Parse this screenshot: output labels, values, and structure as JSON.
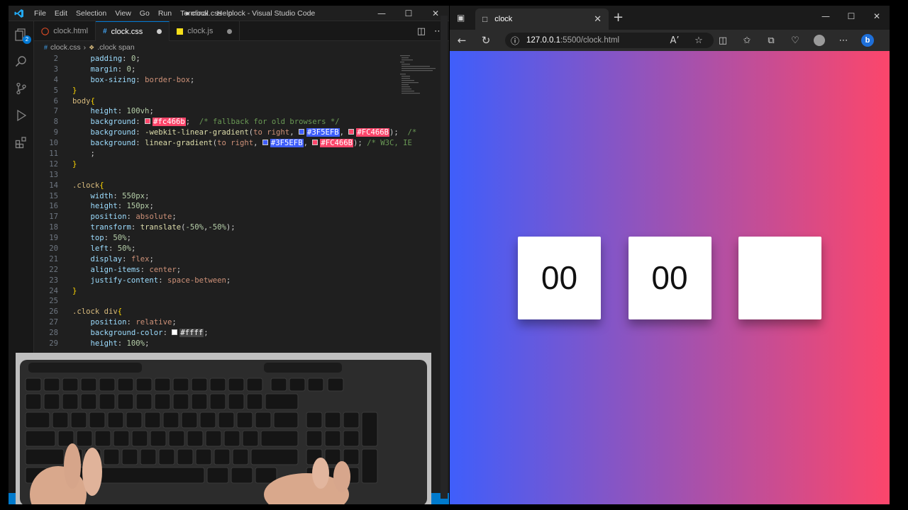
{
  "vscode": {
    "menu": [
      "File",
      "Edit",
      "Selection",
      "View",
      "Go",
      "Run",
      "Terminal",
      "Help"
    ],
    "title": "● clock.css - clock - Visual Studio Code",
    "activity_badge": "2",
    "tabs": [
      {
        "label": "clock.html",
        "icon": "html5-icon"
      },
      {
        "label": "clock.css",
        "icon": "css3-icon"
      },
      {
        "label": "clock.js",
        "icon": "js-icon"
      }
    ],
    "breadcrumb": [
      "clock.css",
      ".clock span"
    ],
    "code_lines": [
      {
        "n": "2",
        "text": "    padding: 0;"
      },
      {
        "n": "3",
        "text": "    margin: 0;"
      },
      {
        "n": "4",
        "text": "    box-sizing: border-box;"
      },
      {
        "n": "5",
        "text": "}"
      },
      {
        "n": "6",
        "text": "body{"
      },
      {
        "n": "7",
        "text": "    height: 100vh;"
      },
      {
        "n": "8",
        "text": "    background: #fc466b;  /* fallback for old browsers */"
      },
      {
        "n": "9",
        "text": "    background: -webkit-linear-gradient(to right, #3F5EFB, #FC466B);  /*"
      },
      {
        "n": "10",
        "text": "    background: linear-gradient(to right, #3F5EFB, #FC466B); /* W3C, IE"
      },
      {
        "n": "11",
        "text": "    ;"
      },
      {
        "n": "12",
        "text": "}"
      },
      {
        "n": "13",
        "text": ""
      },
      {
        "n": "14",
        "text": ".clock{"
      },
      {
        "n": "15",
        "text": "    width: 550px;"
      },
      {
        "n": "16",
        "text": "    height: 150px;"
      },
      {
        "n": "17",
        "text": "    position: absolute;"
      },
      {
        "n": "18",
        "text": "    transform: translate(-50%,-50%);"
      },
      {
        "n": "19",
        "text": "    top: 50%;"
      },
      {
        "n": "20",
        "text": "    left: 50%;"
      },
      {
        "n": "21",
        "text": "    display: flex;"
      },
      {
        "n": "22",
        "text": "    align-items: center;"
      },
      {
        "n": "23",
        "text": "    justify-content: space-between;"
      },
      {
        "n": "24",
        "text": "}"
      },
      {
        "n": "25",
        "text": ""
      },
      {
        "n": "26",
        "text": ".clock div{"
      },
      {
        "n": "27",
        "text": "    position: relative;"
      },
      {
        "n": "28",
        "text": "    background-color: #ffff;"
      },
      {
        "n": "29",
        "text": "    height: 100%;"
      }
    ]
  },
  "browser": {
    "tab_title": "clock",
    "url_host": "127.0.0.1",
    "url_rest": ":5500/clock.html",
    "clock_boxes": [
      "00",
      "00",
      ""
    ]
  },
  "colors": {
    "gradient_start": "#3F5EFB",
    "gradient_end": "#FC466B",
    "vscode_accent": "#007acc"
  }
}
